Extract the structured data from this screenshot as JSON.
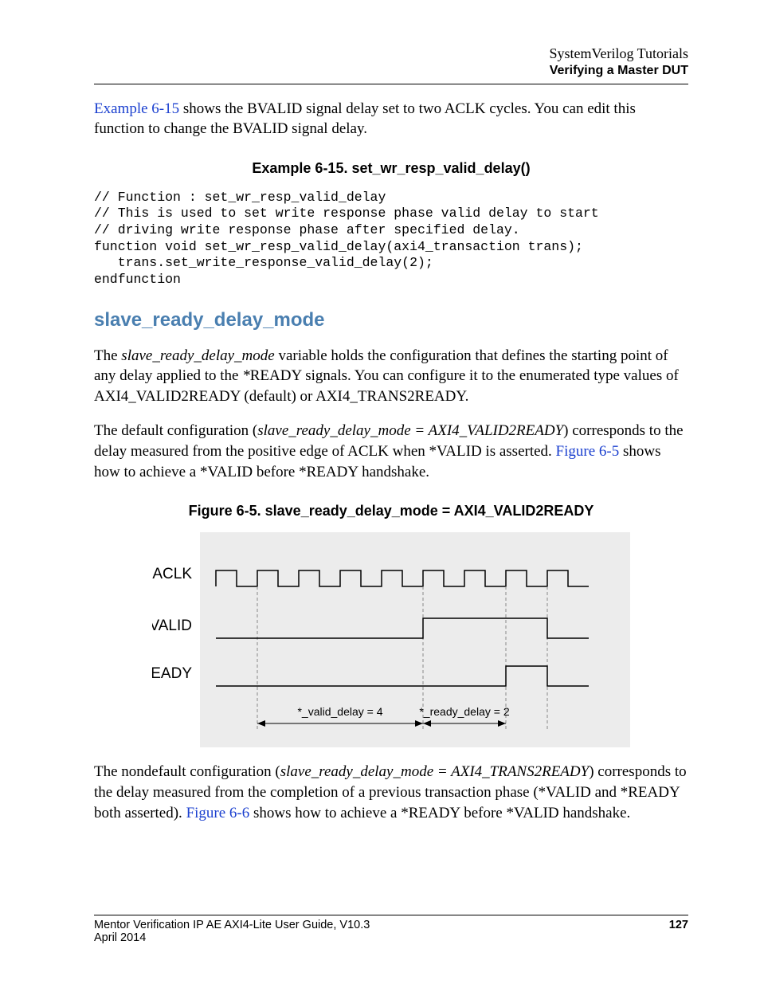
{
  "header": {
    "line1": "SystemVerilog Tutorials",
    "line2": "Verifying a Master DUT"
  },
  "paras": {
    "intro_link": "Example 6-15",
    "intro_rest": " shows the BVALID signal delay set to two ACLK cycles. You can edit this function to change the BVALID signal delay.",
    "example_title": "Example 6-15. set_wr_resp_valid_delay()",
    "code": "// Function : set_wr_resp_valid_delay\n// This is used to set write response phase valid delay to start\n// driving write response phase after specified delay.\nfunction void set_wr_resp_valid_delay(axi4_transaction trans);\n   trans.set_write_response_valid_delay(2);\nendfunction",
    "h2": "slave_ready_delay_mode",
    "p2a": "The ",
    "p2em1": "slave_ready_delay_mode",
    "p2b": " variable holds the configuration that defines the starting point of any delay applied to the ",
    "p2em2": "*",
    "p2c": "READY signals. You can configure it to the enumerated type values of AXI4_VALID2READY (default) or AXI4_TRANS2READY.",
    "p3a": "The default configuration (",
    "p3em": "slave_ready_delay_mode = AXI4_VALID2READY",
    "p3b": ") corresponds to the delay measured from the positive edge of ACLK when *VALID is asserted. ",
    "p3link": "Figure 6-5",
    "p3c": " shows how to achieve a *VALID before *READY handshake.",
    "fig_title": "Figure 6-5. slave_ready_delay_mode = AXI4_VALID2READY",
    "p4a": "The nondefault configuration (",
    "p4em": "slave_ready_delay_mode = AXI4_TRANS2READY",
    "p4b": ") corresponds to the delay measured from the completion of a previous transaction phase (*VALID and *READY both asserted). ",
    "p4link": "Figure 6-6",
    "p4c": " shows how to achieve a *READY before *VALID handshake."
  },
  "figure": {
    "labels": {
      "aclk": "ACLK",
      "valid": "*VALID",
      "ready": "*READY"
    },
    "annotations": {
      "valid_delay": "*_valid_delay = 4",
      "ready_delay": "*_ready_delay = 2"
    }
  },
  "chart_data": {
    "type": "timing-diagram",
    "clock": "ACLK",
    "clock_cycles_shown": 9,
    "signals": [
      {
        "name": "*VALID",
        "rises_at_cycle": 4,
        "falls_at_cycle": 7
      },
      {
        "name": "*READY",
        "rises_at_cycle": 6,
        "falls_at_cycle": 7
      }
    ],
    "annotations": [
      {
        "label": "*_valid_delay",
        "value": 4,
        "span_cycles": [
          0,
          4
        ]
      },
      {
        "label": "*_ready_delay",
        "value": 2,
        "span_cycles": [
          4,
          6
        ]
      }
    ],
    "note": "Delays measured from positive ACLK edge when *VALID asserted (AXI4_VALID2READY mode)."
  },
  "footer": {
    "title": "Mentor Verification IP AE AXI4-Lite User Guide, V10.3",
    "date": "April 2014",
    "page": "127"
  }
}
